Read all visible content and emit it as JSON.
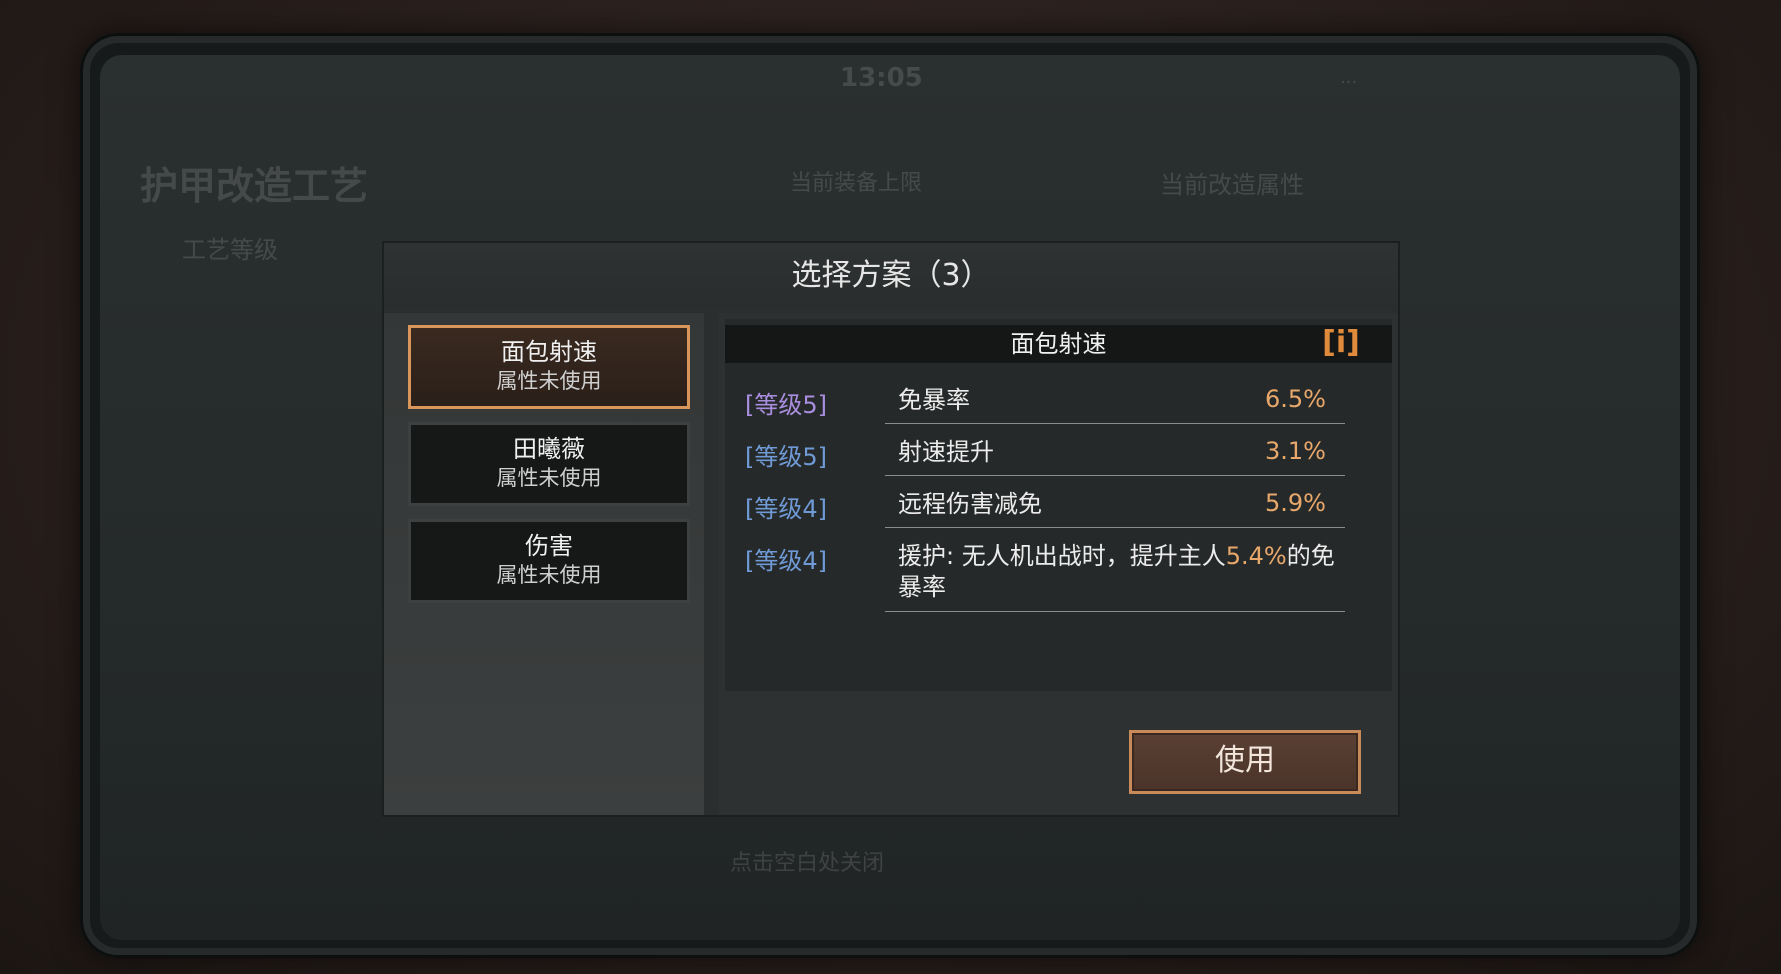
{
  "background": {
    "time": "13:05",
    "status_right": "...",
    "title": "护甲改造工艺",
    "level_label": "工艺等级",
    "limit_text": "当前装备上限",
    "compare_label": "当前改造属性",
    "hint": "点击空白处关闭"
  },
  "modal": {
    "title": "选择方案（3）",
    "options": [
      {
        "name": "面包射速",
        "status": "属性未使用",
        "selected": true
      },
      {
        "name": "田曦薇",
        "status": "属性未使用",
        "selected": false
      },
      {
        "name": "伤害",
        "status": "属性未使用",
        "selected": false
      }
    ],
    "detail": {
      "header": "面包射速",
      "info_icon": "[i]",
      "rows": [
        {
          "level": "[等级5]",
          "text": "免暴率",
          "value": "6.5%"
        },
        {
          "level": "[等级5]",
          "text": "射速提升",
          "value": "3.1%"
        },
        {
          "level": "[等级4]",
          "text": "远程伤害减免",
          "value": "5.9%"
        },
        {
          "level": "[等级4]",
          "text_before": "援护: 无人机出战时，提升主人",
          "text_value": "5.4%",
          "text_after": "的免暴率"
        }
      ]
    },
    "use_button": "使用"
  },
  "colors": {
    "accent_orange": "#d9955a",
    "value_orange": "#e8a86b",
    "level_blue": "#6f9ad6",
    "level_purple": "#a98ee0"
  }
}
